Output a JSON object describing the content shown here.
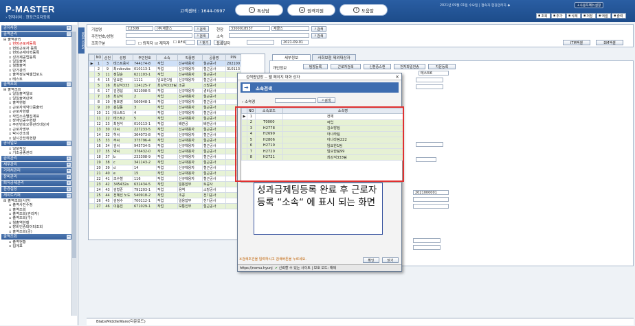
{
  "header": {
    "logo": "P-MASTER",
    "breadcrumb": "› 현재위치 : 현장근로자등록",
    "call_center": "고객센터 : 1644-0997",
    "buttons": [
      {
        "label": "톡상담",
        "icon": "💬"
      },
      {
        "label": "원격지원",
        "icon": "⌂"
      },
      {
        "label": "도움말",
        "icon": "?"
      }
    ],
    "user_info": "2021년 09월 01일 수요일 | 접속자 현장관리자 ◆",
    "my_menu": "+사용자메뉴설정"
  },
  "toolbar": [
    "조회",
    "추가",
    "삭제",
    "저장",
    "엑셀",
    "출력"
  ],
  "sidebar": {
    "sections": [
      {
        "title": "공지사항",
        "items": []
      },
      {
        "title": "출역관리",
        "items": [
          {
            "label": "출역관리",
            "lvl": 1
          },
          {
            "label": "현장근로자등록",
            "lvl": 2,
            "sel": true
          },
          {
            "label": "현장근로자 등록",
            "lvl": 2
          },
          {
            "label": "현장근재이력등록",
            "lvl": 2
          },
          {
            "label": "성과제공립등록",
            "lvl": 2
          },
          {
            "label": "일일출역",
            "lvl": 2
          },
          {
            "label": "월별출역",
            "lvl": 2
          },
          {
            "label": "단가관리",
            "lvl": 2
          },
          {
            "label": "출역정보엑셀업로드",
            "lvl": 2
          },
          {
            "label": "테스트",
            "lvl": 2
          }
        ]
      },
      {
        "title": "출역조회",
        "items": [
          {
            "label": "출역조회",
            "lvl": 1
          },
          {
            "label": "일일출역일보",
            "lvl": 2
          },
          {
            "label": "일일출역내역",
            "lvl": 2
          },
          {
            "label": "출역현황",
            "lvl": 2
          },
          {
            "label": "근로자계약다중출력",
            "lvl": 2
          },
          {
            "label": "근로자현황",
            "lvl": 2
          },
          {
            "label": "작업소속별집계표",
            "lvl": 2
          },
          {
            "label": "장애인공수현황",
            "lvl": 2
          },
          {
            "label": "주민번호오류관리대상자",
            "lvl": 2
          },
          {
            "label": "근로자명부",
            "lvl": 2
          },
          {
            "label": "탁시간조회",
            "lvl": 2
          },
          {
            "label": "실시간전취현황",
            "lvl": 2
          }
        ]
      },
      {
        "title": "공사일보",
        "items": [
          {
            "label": "일보작성",
            "lvl": 2
          },
          {
            "label": "기초공종관리",
            "lvl": 2
          }
        ]
      },
      {
        "title": "급여관리",
        "items": []
      },
      {
        "title": "세무관리",
        "items": []
      },
      {
        "title": "거래처관리",
        "items": []
      },
      {
        "title": "장비관리",
        "items": []
      },
      {
        "title": "퇴직공제관리",
        "items": []
      },
      {
        "title": "환경설정",
        "items": []
      },
      {
        "title": "게이트키퍼",
        "items": [
          {
            "label": "출역조회(사진)",
            "lvl": 1
          },
          {
            "label": "출역사진수정",
            "lvl": 2
          },
          {
            "label": "출역조회",
            "lvl": 2
          },
          {
            "label": "출역조회(관리자)",
            "lvl": 2
          },
          {
            "label": "출역조회(구)",
            "lvl": 2
          },
          {
            "label": "월출역현황",
            "lvl": 2
          },
          {
            "label": "장비인증데이터조회",
            "lvl": 2
          },
          {
            "label": "출역조회(금)",
            "lvl": 2
          }
        ]
      },
      {
        "title": "출역조회",
        "items": [
          {
            "label": "출역현황",
            "lvl": 2
          },
          {
            "label": "집계표",
            "lvl": 2
          }
        ]
      }
    ],
    "menu_tab": "MENU OPEN"
  },
  "search": {
    "company_label": "기업명",
    "company_code": "C2308",
    "company_name": "(주)재클스",
    "person_label": "주민번호/성명",
    "retire_label": "조회구분",
    "retire_opts": [
      "퇴직자",
      "재직자",
      "RFID"
    ],
    "site_label": "현장",
    "site_code": "3300018537",
    "site_name": "재클스",
    "dept_label": "소속",
    "reg_label": "등록일자",
    "reg_date": "2021-09-01",
    "search_btn": "검색",
    "find_btn": "찾기",
    "excel_btn": "ITM엑셀",
    "dm_btn": "DM엑셀"
  },
  "grid": {
    "headers": [
      "NO",
      "순번",
      "성명",
      "주민번호",
      "소속",
      "직종명",
      "공종명",
      "PIN"
    ],
    "rows": [
      [
        "1",
        "3",
        "테스트용사",
        "744174-8",
        "작업",
        "신규채용자",
        "철근공사",
        "202100"
      ],
      [
        "2",
        "9",
        "최cvbcvbc",
        "010113-1",
        "작업",
        "신규채용자",
        "철근공사",
        "310113"
      ],
      [
        "3",
        "11",
        "정길순",
        "621103-1",
        "작업",
        "신규채용자",
        "철근공사",
        ""
      ],
      [
        "4",
        "15",
        "임요한",
        "1111",
        "임요한1팀",
        "신규채용자",
        "철근공사",
        ""
      ],
      [
        "5",
        "16",
        "최강석333",
        "124125-7",
        "최강석333팀",
        "조공",
        "소방공사",
        ""
      ],
      [
        "6",
        "17",
        "김경섭",
        "921008-5",
        "작업",
        "신규채용자",
        "경비공사",
        ""
      ],
      [
        "7",
        "18",
        "최강석",
        "2",
        "작업",
        "신규채용자",
        "철근공사",
        ""
      ],
      [
        "8",
        "19",
        "정호영",
        "560948-1",
        "작업",
        "신규채용자",
        "철근공사",
        ""
      ],
      [
        "9",
        "20",
        "홍길동",
        "3",
        "작업",
        "신규채용자",
        "철근공사",
        ""
      ],
      [
        "10",
        "21",
        "테스트1",
        "4",
        "작업",
        "신규채용자",
        "철근공사",
        ""
      ],
      [
        "11",
        "22",
        "테스트2",
        "5",
        "작업",
        "신규채용자",
        "철근공사",
        ""
      ],
      [
        "12",
        "23",
        "최정석",
        "010113-1",
        "작업",
        "배관공",
        "배관공사",
        ""
      ],
      [
        "13",
        "30",
        "이씨",
        "227233-5",
        "작업",
        "신규채용자",
        "철근공사",
        ""
      ],
      [
        "14",
        "32",
        "허씨",
        "364073-8",
        "작업",
        "신규채용자",
        "철근공사",
        ""
      ],
      [
        "15",
        "33",
        "주씨",
        "375796-4",
        "작업",
        "신규채용자",
        "철근공사",
        ""
      ],
      [
        "16",
        "34",
        "김씨",
        "945734-5",
        "작업",
        "신규채용자",
        "철근공사",
        ""
      ],
      [
        "17",
        "35",
        "박씨",
        "376432-0",
        "작업",
        "신규채용자",
        "철근공사",
        ""
      ],
      [
        "18",
        "37",
        "b",
        "233308-9",
        "작업",
        "신규채용자",
        "철근공사",
        ""
      ],
      [
        "19",
        "38",
        "c",
        "341143-2",
        "작업",
        "신규채용자",
        "철근공사",
        ""
      ],
      [
        "20",
        "39",
        "d",
        "14",
        "작업",
        "신규채용자",
        "철근공사",
        ""
      ],
      [
        "21",
        "40",
        "e",
        "15",
        "작업",
        "신규채용자",
        "철근공사",
        ""
      ],
      [
        "22",
        "41",
        "조수철",
        "116",
        "작업",
        "신규채용자",
        "철근공사",
        ""
      ],
      [
        "23",
        "42",
        "345432a",
        "632434-5",
        "작업",
        "일용잡부",
        "토공사",
        ""
      ],
      [
        "24",
        "43",
        "김형준",
        "791203-1",
        "작업",
        "용역",
        "소방공사",
        ""
      ],
      [
        "25",
        "44",
        "전혜선 노도",
        "540918-2",
        "작업",
        "조공",
        "전기공사",
        ""
      ],
      [
        "26",
        "45",
        "김정수",
        "700112-1",
        "작업",
        "일용잡부",
        "전기공사",
        ""
      ],
      [
        "27",
        "46",
        "이동진",
        "671029-1",
        "작업",
        "보통인부",
        "철근공사",
        ""
      ]
    ]
  },
  "right": {
    "tabs": [
      "세부정보",
      "사회보험 제외대상자"
    ],
    "sub_tabs": [
      "팀장등록",
      "근로자검색",
      "신분증스캔",
      "전자파일전송",
      "지문등록"
    ],
    "basic_label": "개인정보",
    "team_value": "테스트6",
    "field_values": [
      "2021000001"
    ]
  },
  "popup": {
    "title": "검색팝업창 -- 웹 페이지 대화 상자",
    "heading": "소속검색",
    "field_label": "소속명",
    "search_btn": "검색",
    "headers": [
      "NO",
      "소속코드",
      "소속명"
    ],
    "rows": [
      [
        "1",
        "",
        "전체"
      ],
      [
        "2",
        "T0000",
        "작업"
      ],
      [
        "3",
        "H2778",
        "김소방팀"
      ],
      [
        "4",
        "H2699",
        "아나라팀"
      ],
      [
        "5",
        "H2806",
        "아나라팀222"
      ],
      [
        "6",
        "H2719",
        "임요한1팀"
      ],
      [
        "7",
        "H2720",
        "임요한팀99"
      ],
      [
        "8",
        "H2721",
        "최강석333팀"
      ]
    ],
    "status": "※검색조건을 입력하시고 검색버튼을 누르세요.",
    "ok_btn": "확인",
    "close_btn": "닫기",
    "url": "https://nomu.hyunj",
    "trust": "신뢰할 수 있는 사이트 | 보호 모드: 해제"
  },
  "note": "성과급제팀등록 완료 후 근로자등록 “소속“ 에 표시 되는 화면",
  "footer": "BlabsMiddleWare(다운로드)"
}
